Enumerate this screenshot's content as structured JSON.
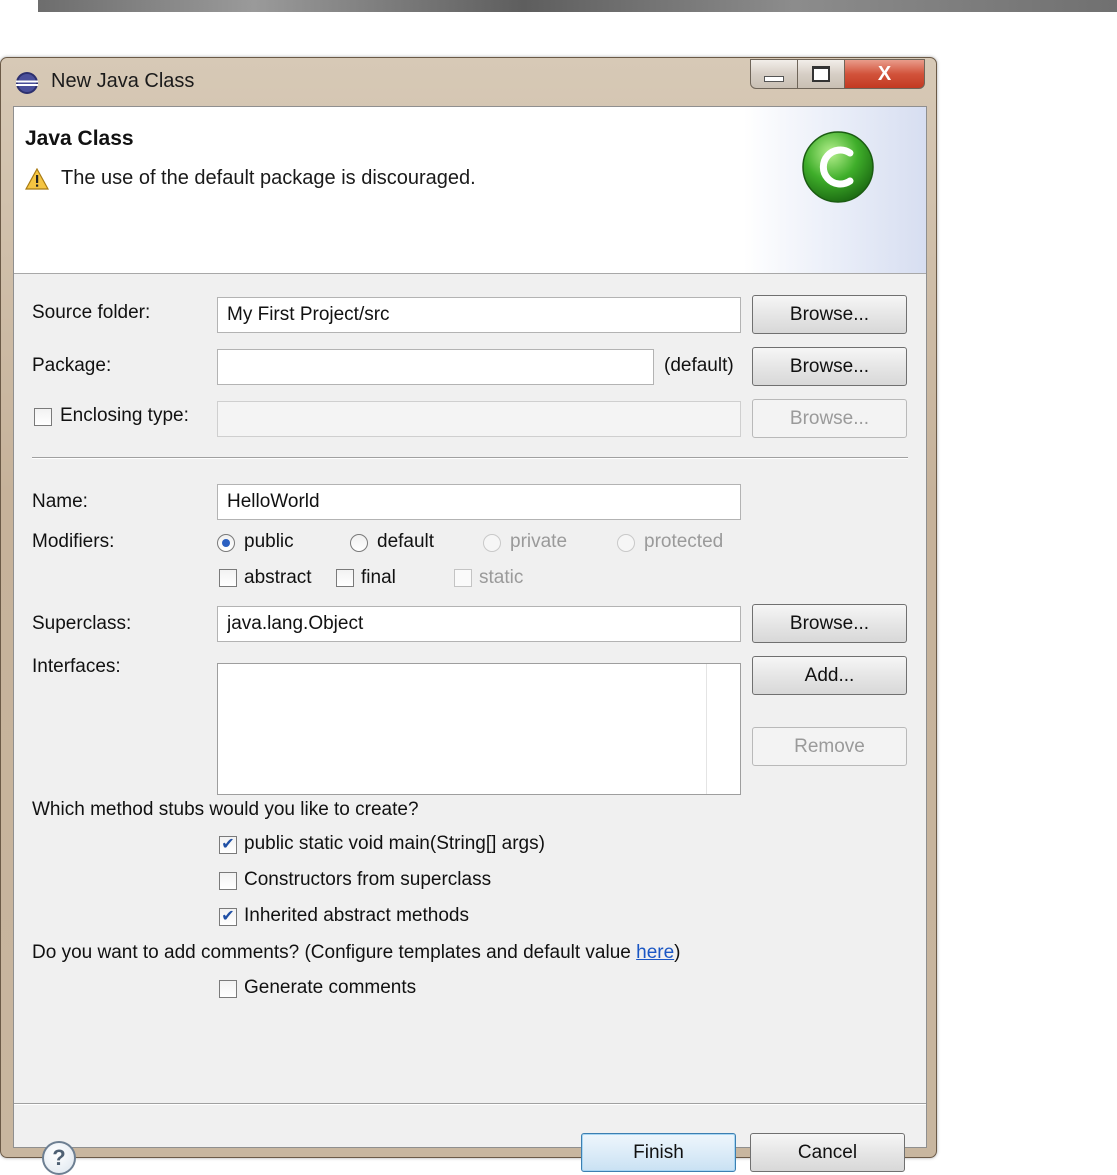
{
  "window": {
    "title": "New Java Class",
    "controls": {
      "minimize": "minimize",
      "maximize": "maximize",
      "close": "X"
    }
  },
  "banner": {
    "title": "Java Class",
    "message": "The use of the default package is discouraged."
  },
  "form": {
    "source_folder": {
      "label": "Source folder:",
      "value": "My First Project/src",
      "browse": "Browse..."
    },
    "package": {
      "label": "Package:",
      "value": "",
      "hint": "(default)",
      "browse": "Browse..."
    },
    "enclosing_type": {
      "label": "Enclosing type:",
      "checked": false,
      "value": "",
      "browse": "Browse..."
    },
    "name": {
      "label": "Name:",
      "value": "HelloWorld"
    },
    "modifiers": {
      "label": "Modifiers:",
      "access": [
        {
          "label": "public",
          "selected": true,
          "enabled": true
        },
        {
          "label": "default",
          "selected": false,
          "enabled": true
        },
        {
          "label": "private",
          "selected": false,
          "enabled": false
        },
        {
          "label": "protected",
          "selected": false,
          "enabled": false
        }
      ],
      "flags": [
        {
          "label": "abstract",
          "checked": false,
          "enabled": true
        },
        {
          "label": "final",
          "checked": false,
          "enabled": true
        },
        {
          "label": "static",
          "checked": false,
          "enabled": false
        }
      ]
    },
    "superclass": {
      "label": "Superclass:",
      "value": "java.lang.Object",
      "browse": "Browse..."
    },
    "interfaces": {
      "label": "Interfaces:",
      "add": "Add...",
      "remove": "Remove",
      "items": []
    },
    "stubs": {
      "question": "Which method stubs would you like to create?",
      "options": [
        {
          "label": "public static void main(String[] args)",
          "checked": true
        },
        {
          "label": "Constructors from superclass",
          "checked": false
        },
        {
          "label": "Inherited abstract methods",
          "checked": true
        }
      ]
    },
    "comments": {
      "question_prefix": "Do you want to add comments? (Configure templates and default value ",
      "link": "here",
      "question_suffix": ")",
      "option": {
        "label": "Generate comments",
        "checked": false
      }
    }
  },
  "footer": {
    "help": "?",
    "finish": "Finish",
    "cancel": "Cancel"
  },
  "colors": {
    "link": "#1a56c4",
    "frame": "#c8b69f",
    "close_button": "#d2533b",
    "badge_green": "#3fae2a"
  },
  "icons": {
    "title": "eclipse-icon",
    "warning": "warning-icon",
    "badge": "java-class-icon",
    "help": "help-icon"
  }
}
